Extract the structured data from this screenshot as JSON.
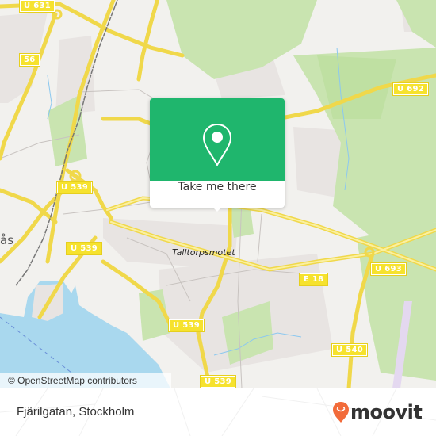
{
  "map": {
    "place_labels": [
      {
        "name": "Talltorpsmotet"
      },
      {
        "name": "ås"
      }
    ],
    "road_shields": [
      {
        "label": "U 631"
      },
      {
        "label": "56"
      },
      {
        "label": "U 539"
      },
      {
        "label": "U 539"
      },
      {
        "label": "U 539"
      },
      {
        "label": "U 539"
      },
      {
        "label": "U 692"
      },
      {
        "label": "U 693"
      },
      {
        "label": "E 18"
      },
      {
        "label": "U 540"
      }
    ],
    "colors": {
      "land": "#f2f1ee",
      "residential": "#e8e4e2",
      "forest": "#c9e4b0",
      "water": "#a9d8ee",
      "road": "#f6e06b",
      "rail": "#777777"
    },
    "attribution": "© OpenStreetMap contributors"
  },
  "popup": {
    "icon": "location-pin-icon",
    "button_label": "Take me there",
    "accent": "#1fb66d"
  },
  "footer": {
    "address": "Fjärilgatan, Stockholm",
    "brand": "moovit",
    "brand_color": "#f26b3a"
  }
}
